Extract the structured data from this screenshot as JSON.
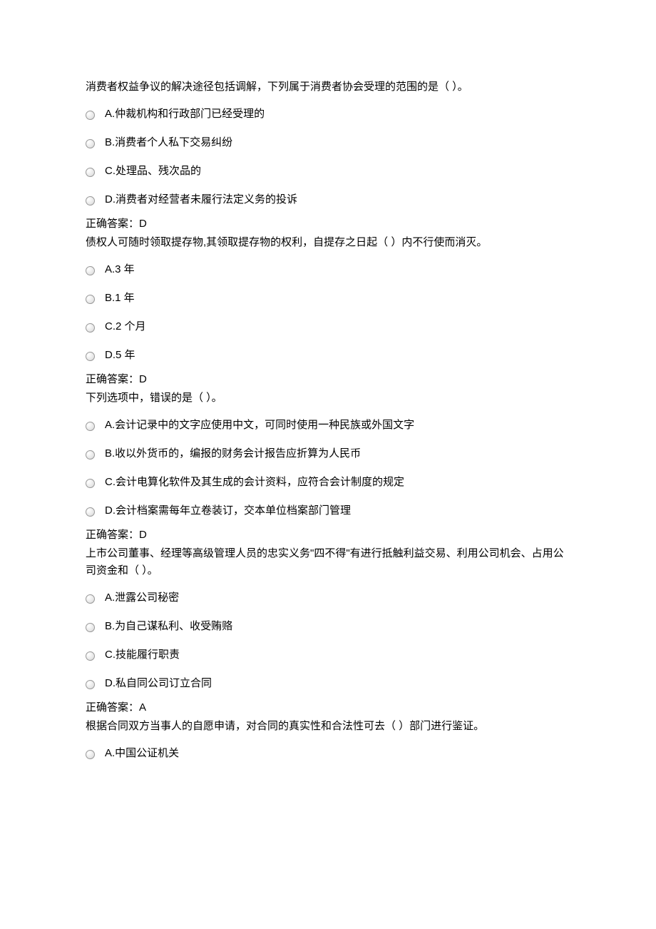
{
  "questions": [
    {
      "prompt": "消费者权益争议的解决途径包括调解，下列属于消费者协会受理的范围的是（ ）。",
      "options": [
        "A.仲裁机构和行政部门已经受理的",
        "B.消费者个人私下交易纠纷",
        "C.处理品、残次品的",
        "D.消费者对经营者未履行法定义务的投诉"
      ],
      "answer": "正确答案：D"
    },
    {
      "prompt": "债权人可随时领取提存物,其领取提存物的权利，自提存之日起（ ）内不行使而消灭。",
      "options": [
        "A.3 年",
        "B.1 年",
        "C.2 个月",
        "D.5 年"
      ],
      "answer": "正确答案：D"
    },
    {
      "prompt": "下列选项中，错误的是（ ）。",
      "options": [
        "A.会计记录中的文字应使用中文，可同时使用一种民族或外国文字",
        "B.收以外货币的，编报的财务会计报告应折算为人民币",
        "C.会计电算化软件及其生成的会计资料，应符合会计制度的规定",
        "D.会计档案需每年立卷装订，交本单位档案部门管理"
      ],
      "answer": "正确答案：D"
    },
    {
      "prompt": "上市公司董事、经理等高级管理人员的忠实义务\"四不得\"有进行抵触利益交易、利用公司机会、占用公司资金和（ ）。",
      "options": [
        "A.泄露公司秘密",
        "B.为自己谋私利、收受贿赂",
        "C.技能履行职责",
        "D.私自同公司订立合同"
      ],
      "answer": "正确答案：A"
    },
    {
      "prompt": "根据合同双方当事人的自愿申请，对合同的真实性和合法性可去（ ）部门进行鉴证。",
      "options": [
        "A.中国公证机关"
      ],
      "answer": ""
    }
  ]
}
